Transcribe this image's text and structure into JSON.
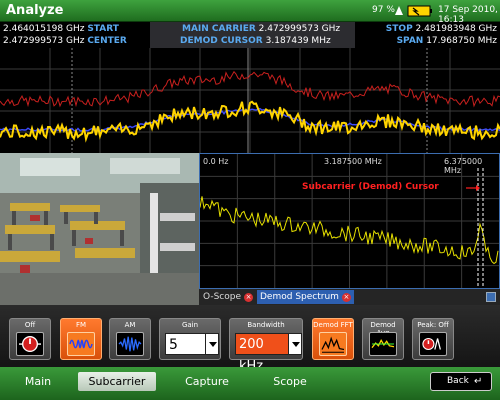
{
  "app": {
    "title": "Analyze"
  },
  "status": {
    "battery": "97 %",
    "datetime": "17 Sep 2010, 16:13"
  },
  "info": {
    "start_value": "2.464015198 GHz",
    "start_key": "START",
    "center_value": "2.472999573 GHz",
    "center_key": "CENTER",
    "main_carrier_key": "MAIN CARRIER",
    "main_carrier_value": "2.472999573 GHz",
    "demod_cursor_key": "DEMOD CURSOR",
    "demod_cursor_value": "3.187439 MHz",
    "stop_key": "STOP",
    "stop_value": "2.481983948 GHz",
    "span_key": "SPAN",
    "span_value": "17.968750 MHz"
  },
  "demod": {
    "freq_left": "0.0 Hz",
    "freq_mid": "3.187500 MHz",
    "freq_right": "6.375000 MHz",
    "cursor_label": "Subcarrier (Demod) Cursor"
  },
  "tabs": [
    {
      "label": "O-Scope"
    },
    {
      "label": "Demod Spectrum"
    }
  ],
  "controls": {
    "off": "Off",
    "fm": "FM",
    "am": "AM",
    "gain_label": "Gain",
    "gain_value": "5",
    "bandwidth_label": "Bandwidth",
    "bandwidth_value": "200 kHz",
    "demod_fft": "Demod FFT",
    "demod_avg": "Demod Avg",
    "peak": "Peak: Off"
  },
  "nav": {
    "main": "Main",
    "subcarrier": "Subcarrier",
    "capture": "Capture",
    "scope": "Scope",
    "back": "Back"
  },
  "colors": {
    "accent_green": "#2e8b2e",
    "active_orange": "#ff7a2e",
    "trace_yellow": "#ffd400",
    "trace_red": "#c8201e",
    "trace_blue": "#3c4cff"
  }
}
